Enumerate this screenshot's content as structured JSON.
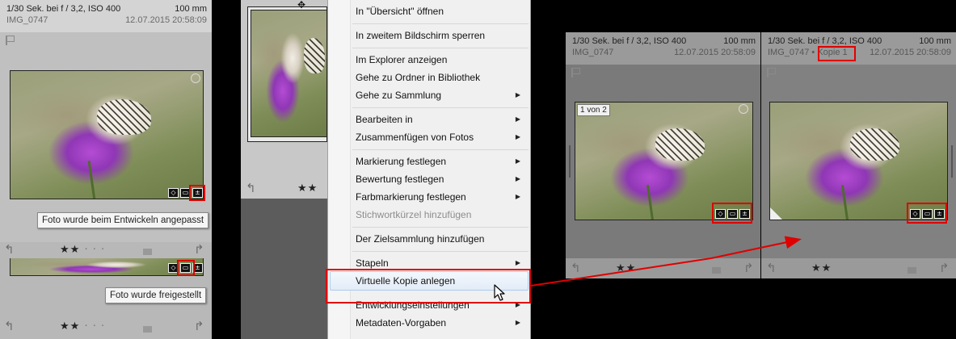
{
  "photo_info": {
    "exposure": "1/30 Sek. bei f / 3,2, ISO 400",
    "focal_length": "100 mm",
    "filename": "IMG_0747",
    "date": "12.07.2015 20:58:09",
    "copy_name": "Kopie 1"
  },
  "left_panel": {
    "tooltip_developed": "Foto wurde beim Entwickeln angepasst",
    "tooltip_cropped": "Foto wurde freigestellt",
    "rating": "★★",
    "dots": "· · ·"
  },
  "middle_panel": {
    "rating": "★★"
  },
  "context_menu": {
    "items": [
      {
        "label": "In \"Übersicht\" öffnen",
        "submenu": false,
        "disabled": false
      },
      {
        "label": "In zweitem Bildschirm sperren",
        "submenu": false,
        "disabled": false
      },
      {
        "label": "Im Explorer anzeigen",
        "submenu": false,
        "disabled": false
      },
      {
        "label": "Gehe zu Ordner in Bibliothek",
        "submenu": false,
        "disabled": false
      },
      {
        "label": "Gehe zu Sammlung",
        "submenu": true,
        "disabled": false
      },
      {
        "label": "Bearbeiten in",
        "submenu": true,
        "disabled": false
      },
      {
        "label": "Zusammenfügen von Fotos",
        "submenu": true,
        "disabled": false
      },
      {
        "label": "Markierung festlegen",
        "submenu": true,
        "disabled": false
      },
      {
        "label": "Bewertung festlegen",
        "submenu": true,
        "disabled": false
      },
      {
        "label": "Farbmarkierung festlegen",
        "submenu": true,
        "disabled": false
      },
      {
        "label": "Stichwortkürzel hinzufügen",
        "submenu": false,
        "disabled": true
      },
      {
        "label": "Der Zielsammlung hinzufügen",
        "submenu": false,
        "disabled": false
      },
      {
        "label": "Stapeln",
        "submenu": true,
        "disabled": false
      },
      {
        "label": "Virtuelle Kopie anlegen",
        "submenu": false,
        "disabled": false,
        "highlighted": true
      },
      {
        "label": "Entwicklungseinstellungen",
        "submenu": true,
        "disabled": false
      },
      {
        "label": "Metadaten-Vorgaben",
        "submenu": true,
        "disabled": false
      }
    ],
    "submenu_arrow": "▶"
  },
  "right_panel": {
    "stack_badge": "1 von 2",
    "rating": "★★"
  },
  "colors": {
    "annotation_red": "#e00000",
    "menu_highlight": "#aecbee"
  },
  "icons": {
    "keyword": "tag-icon",
    "crop": "crop-icon",
    "develop": "develop-adjust-icon",
    "rotate_left": "rotate-left-icon",
    "rotate_right": "rotate-right-icon",
    "cursor": "arrow-cursor-icon",
    "move": "move-cursor-icon"
  }
}
